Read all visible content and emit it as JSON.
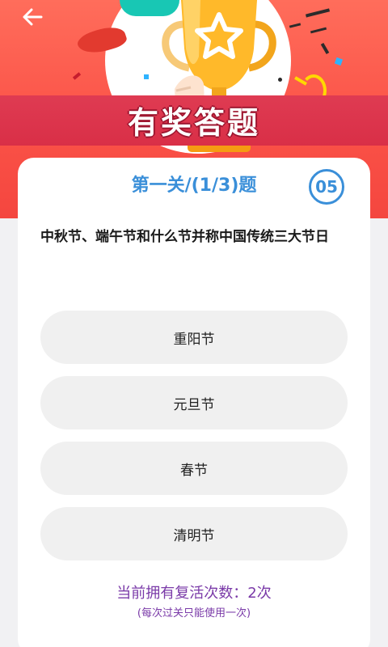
{
  "header": {
    "banner_title": "有奖答题"
  },
  "quiz": {
    "level_title": "第一关/(1/3)题",
    "timer": "05",
    "question": "中秋节、端午节和什么节并称中国传统三大节日",
    "options": [
      {
        "label": "重阳节"
      },
      {
        "label": "元旦节"
      },
      {
        "label": "春节"
      },
      {
        "label": "清明节"
      }
    ]
  },
  "footer": {
    "revive_text": "当前拥有复活次数：2次",
    "revive_note": "(每次过关只能使用一次)"
  },
  "colors": {
    "header_red": "#fb5348",
    "banner_band": "#df3b52",
    "accent_blue": "#3a8fd9",
    "option_bg": "#f0f0f0",
    "revive_purple": "#7a3aa8"
  }
}
